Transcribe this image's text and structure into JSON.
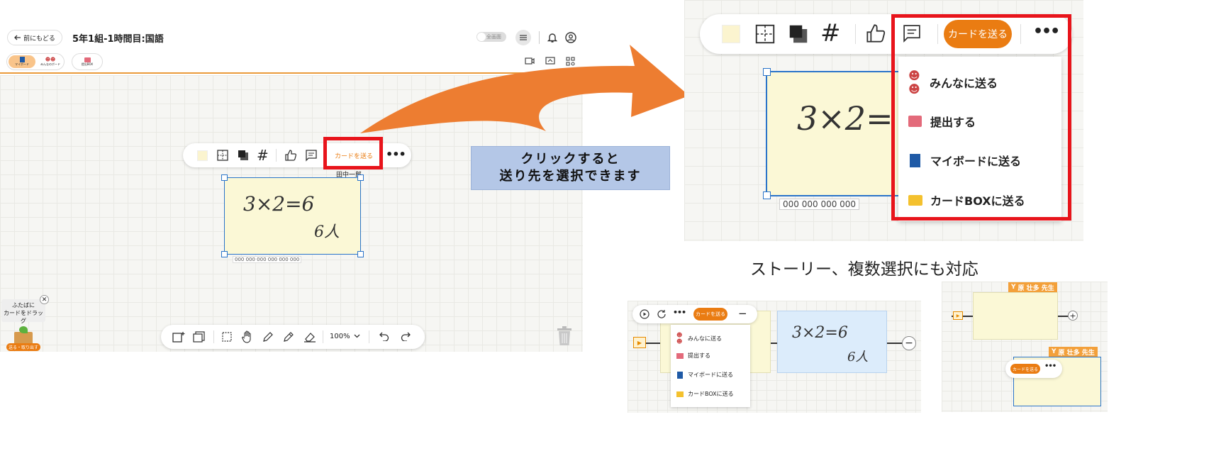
{
  "app": {
    "back_label": "前にもどる",
    "title": "5年1組-1時間目:国語",
    "fullscreen_toggle": "全画面",
    "tabs": [
      {
        "label": "マイボード"
      },
      {
        "label": "みんなのボード"
      },
      {
        "label": "提出BOX"
      }
    ],
    "card_author": "田中一郎",
    "card_line1": "3×2=6",
    "card_line2": "6人",
    "card_stats": "000 000 000 000 000 000",
    "send_card": "カードを送る",
    "drag_hint_line1": "ふたばに",
    "drag_hint_line2": "カードをドラッグ",
    "tray_label": "送る・取り出す",
    "zoom": "100%"
  },
  "callout": {
    "line1": "クリックすると",
    "line2": "送り先を選択できます"
  },
  "zoomed": {
    "send_card": "カードを送る",
    "card_text": "3×2=",
    "card_stats": "000 000 000 000",
    "menu": [
      {
        "label": "みんなに送る",
        "icon": "people-icon"
      },
      {
        "label": "提出する",
        "icon": "inbox-icon"
      },
      {
        "label": "マイボードに送る",
        "icon": "notebook-icon"
      },
      {
        "label": "カードBOXに送る",
        "icon": "folder-icon"
      }
    ]
  },
  "caption": "ストーリー、複数選択にも対応",
  "story": {
    "send_card": "カードを送る",
    "menu": [
      {
        "label": "みんなに送る"
      },
      {
        "label": "提出する"
      },
      {
        "label": "マイボードに送る"
      },
      {
        "label": "カードBOXに送る"
      }
    ],
    "card_line1": "3×2=6",
    "card_line2": "6人"
  },
  "multi": {
    "teacher1": "原 壮多 先生",
    "teacher2": "原 壮多 先生",
    "send_card": "カードを送る"
  },
  "colors": {
    "accent": "#ea7c12",
    "highlight": "#e8141b",
    "selection": "#2a74c9",
    "callout_bg": "#b4c7e7",
    "arrow": "#ed7d31"
  }
}
